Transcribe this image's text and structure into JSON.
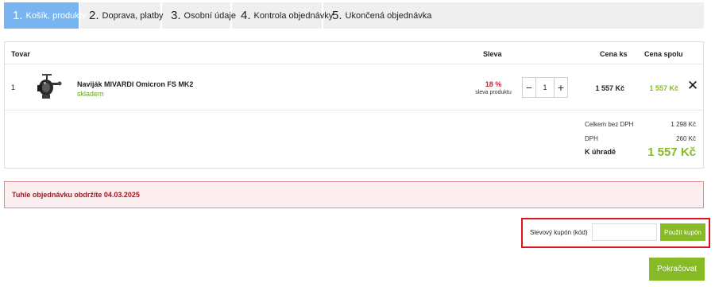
{
  "steps": [
    {
      "num": "1.",
      "label": "Košík, produkty",
      "active": true
    },
    {
      "num": "2.",
      "label": "Doprava, platby",
      "active": false
    },
    {
      "num": "3.",
      "label": "Osobní údaje",
      "active": false
    },
    {
      "num": "4.",
      "label": "Kontrola objednávky",
      "active": false
    },
    {
      "num": "5.",
      "label": "Ukončená objednávka",
      "active": false
    }
  ],
  "cart": {
    "headers": {
      "product": "Tovar",
      "discount": "Sleva",
      "unit_price": "Cena ks",
      "total_price": "Cena spolu"
    },
    "items": [
      {
        "index": "1",
        "name": "Naviják MIVARDI Omicron FS MK2",
        "availability": "skladem",
        "discount": "18 %",
        "discount_label": "sleva produktu",
        "quantity": "1",
        "unit_price": "1 557 Kč",
        "total_price": "1 557 Kč"
      }
    ],
    "summary": {
      "net_label": "Celkem bez DPH",
      "net_value": "1 298 Kč",
      "vat_label": "DPH",
      "vat_value": "260 Kč",
      "due_label": "K úhradě",
      "due_value": "1 557 Kč"
    }
  },
  "alert": {
    "text": "Tuhle objednávku obdržíte 04.03.2025"
  },
  "coupon": {
    "label": "Slevový kupón (kód)",
    "value": "",
    "button": "Použít kupón"
  },
  "continue_button": "Pokračovat",
  "colors": {
    "active_step": "#78b4f0",
    "accent_green": "#87bb26",
    "discount_red": "#d41e2c",
    "alert_text": "#a8141c",
    "highlight_border": "#e0121b"
  },
  "icons": {
    "remove": "close-icon",
    "decrement": "minus-icon",
    "increment": "plus-icon"
  }
}
